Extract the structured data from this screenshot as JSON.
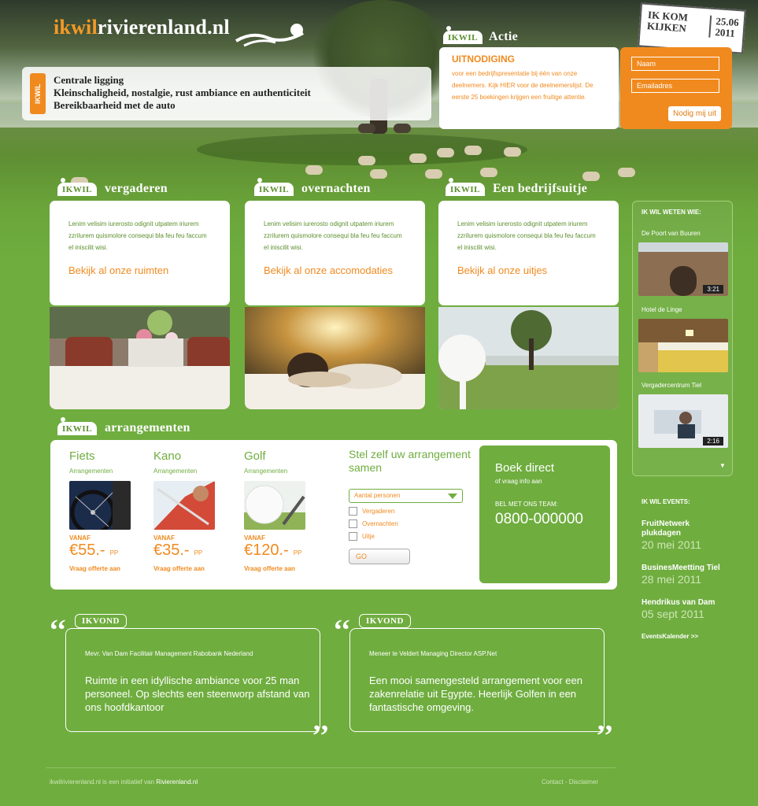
{
  "header": {
    "logo_part1": "ikwil",
    "logo_part2": "rivierenland.nl",
    "usp_tag": "IKWIL",
    "usp_items": [
      "Centrale ligging",
      "Kleinschaligheid, nostalgie, rust ambiance en authenticiteit",
      "Bereikbaarheid met de auto"
    ],
    "stamp_line1": "IK KOM",
    "stamp_line2": "KIJKEN",
    "stamp_date1": "25.06",
    "stamp_date2": "2011"
  },
  "actie": {
    "badge": "IKWIL",
    "title": "Actie",
    "heading": "UITNODIGING",
    "body": "voor een bedrijfspresentatie bij één van onze deelnemers. Kijk HIER voor de deelnemerslijst. De eerste 25 boekingen krijgen een fruitige attentie.",
    "name_placeholder": "Naam",
    "email_placeholder": "Emailadres",
    "submit_label": "Nodig mij uit"
  },
  "columns": [
    {
      "badge": "IKWIL",
      "title": "vergaderen",
      "text": "Lenim velisim iurerosto odignit utpatem iriurem zzrilurem quismolore consequi bla feu feu faccum el iniscilit wisi.",
      "link": "Bekijk al onze ruimten"
    },
    {
      "badge": "IKWIL",
      "title": "overnachten",
      "text": "Lenim velisim iurerosto odignit utpatem iriurem zzrilurem quismolore consequi bla feu feu faccum el iniscilit wisi.",
      "link": "Bekijk al onze accomodaties"
    },
    {
      "badge": "IKWIL",
      "title": "Een bedrijfsuitje",
      "text": "Lenim velisim iurerosto odignit utpatem iriurem zzrilurem quismolore consequi bla feu feu faccum el iniscilit wisi.",
      "link": "Bekijk al onze uitjes"
    }
  ],
  "sidebar": {
    "heading": "IK WIL WETEN WIE:",
    "items": [
      {
        "name": "De Poort van Buuren",
        "duration": "3:21"
      },
      {
        "name": "Hotel de Linge",
        "duration": ""
      },
      {
        "name": "Vergadercentrum Tiel",
        "duration": "2:16"
      }
    ],
    "more_icon": "▼"
  },
  "events": {
    "heading": "IK WIL EVENTS:",
    "items": [
      {
        "title": "FruitNetwerk plukdagen",
        "date": "20 mei 2011"
      },
      {
        "title": "BusinesMeetting Tiel",
        "date": "28 mei 2011"
      },
      {
        "title": "Hendrikus van Dam",
        "date": "05 sept 2011"
      }
    ],
    "calendar_link": "EventsKalender >>"
  },
  "arrangementen": {
    "badge": "IKWIL",
    "title": "arrangementen",
    "products": [
      {
        "name": "Fiets",
        "sub": "Arrangementen",
        "vanaf": "VANAF",
        "price": "€55.-",
        "pp": "PP",
        "quote": "Vraag offerte aan"
      },
      {
        "name": "Kano",
        "sub": "Arrangementen",
        "vanaf": "VANAF",
        "price": "€35.-",
        "pp": "PP",
        "quote": "Vraag offerte aan"
      },
      {
        "name": "Golf",
        "sub": "Arrangementen",
        "vanaf": "VANAF",
        "price": "€120.-",
        "pp": "PP",
        "quote": "Vraag offerte aan"
      }
    ],
    "stel_title": "Stel zelf uw arrangement samen",
    "select_value": "Aantal personen",
    "checkboxes": [
      "Vergaderen",
      "Overnachten",
      "Uitje"
    ],
    "go_label": "GO",
    "boek_title": "Boek direct",
    "boek_sub": "of vraag info aan",
    "team_label": "BEL MET ONS TEAM:",
    "phone": "0800-000000"
  },
  "quotes": [
    {
      "tag": "IKVOND",
      "who": "Mevr. Van Dam Facilitair Management Rabobank Nederland",
      "text": "Ruimte in een idyllische ambiance voor 25 man personeel. Op slechts een steenworp afstand van ons hoofdkantoor"
    },
    {
      "tag": "IKVOND",
      "who": "Meneer te Veldert Managing Director ASP.Net",
      "text": "Een mooi samengesteld arrangement voor een zakenrelatie uit Egypte. Heerlijk Golfen in een fantastische omgeving."
    }
  ],
  "footer": {
    "left_prefix": "ikwilrivierenland.nl is een initiatief van",
    "left_link": "Rivierenland.nl",
    "contact": "Contact",
    "sep": "-",
    "disclaimer": "Disclaimer"
  },
  "colors": {
    "green": "#6fad3f",
    "orange": "#f08a1f"
  }
}
